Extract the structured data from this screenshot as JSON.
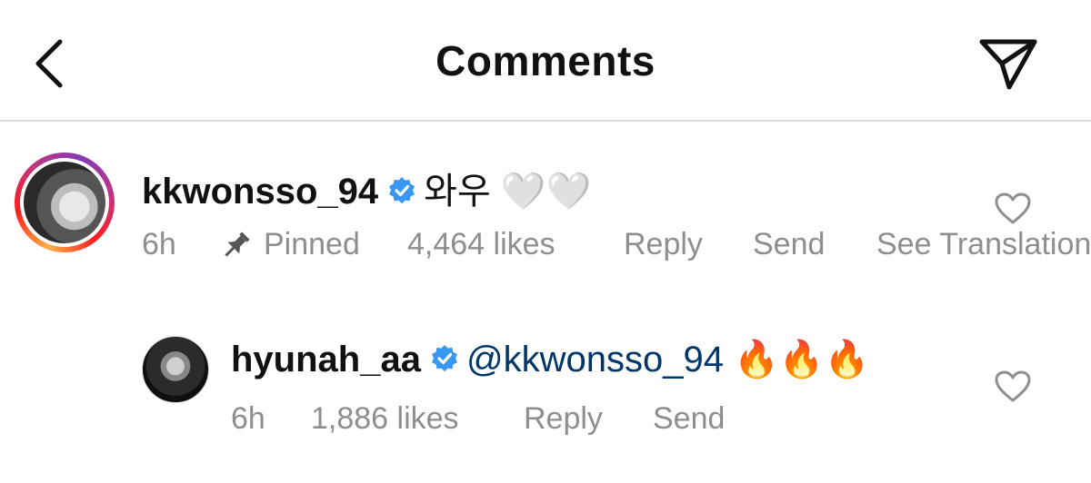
{
  "header": {
    "title": "Comments",
    "back_icon": "chevron-left-icon",
    "send_icon": "paper-plane-icon"
  },
  "comments": [
    {
      "username": "kkwonsso_94",
      "verified": true,
      "text": "와우",
      "emoji": "🤍🤍",
      "time": "6h",
      "pinned_label": "Pinned",
      "likes": "4,464 likes",
      "reply": "Reply",
      "send": "Send",
      "translation": "See Translation"
    },
    {
      "username": "hyunah_aa",
      "verified": true,
      "mention": "@kkwonsso_94",
      "emoji": "🔥🔥🔥",
      "time": "6h",
      "likes": "1,886 likes",
      "reply": "Reply",
      "send": "Send"
    }
  ],
  "colors": {
    "verified_blue": "#3897f0",
    "meta_gray": "#8e8e8e",
    "mention_blue": "#00376b",
    "divider": "#dcdcdc"
  }
}
